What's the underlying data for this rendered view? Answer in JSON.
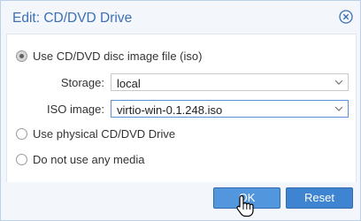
{
  "dialog": {
    "title": "Edit: CD/DVD Drive",
    "close_icon": "close-circle-icon"
  },
  "options": {
    "iso": {
      "label": "Use CD/DVD disc image file (iso)",
      "selected": true
    },
    "storage": {
      "label": "Storage:",
      "value": "local"
    },
    "iso_image": {
      "label": "ISO image:",
      "value": "virtio-win-0.1.248.iso"
    },
    "physical": {
      "label": "Use physical CD/DVD Drive",
      "selected": false
    },
    "none": {
      "label": "Do not use any media",
      "selected": false
    }
  },
  "buttons": {
    "ok": "OK",
    "reset": "Reset"
  },
  "colors": {
    "title": "#3b70b5",
    "button": "#3f84d0",
    "panel": "#f3f6fa"
  },
  "cursor": "hand-pointer-icon"
}
